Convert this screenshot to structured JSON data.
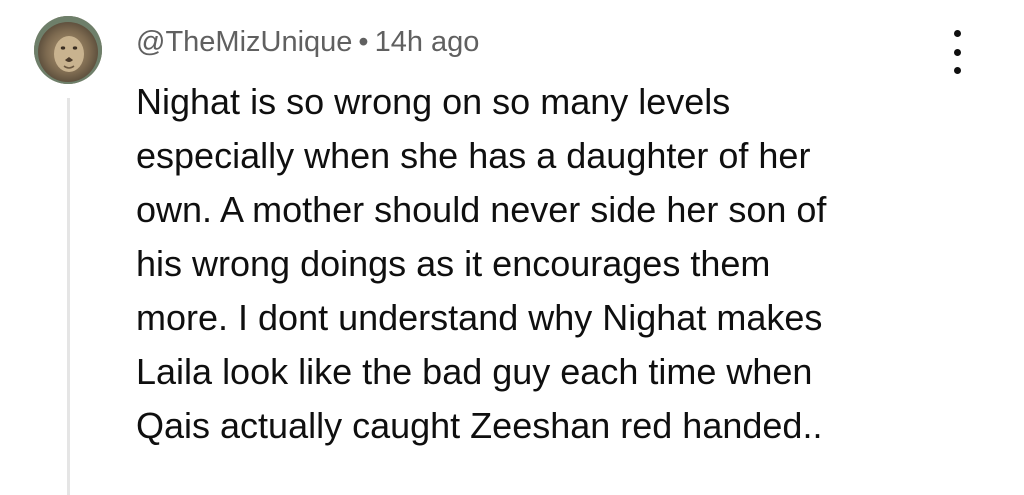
{
  "comment": {
    "avatar_icon": "lion-avatar-icon",
    "author": "@TheMizUnique",
    "separator": "•",
    "time": "14h ago",
    "text_lines": [
      "Nighat is so wrong on so many levels",
      "especially when she has a daughter of her",
      "own. A mother should never side her son of",
      "his wrong doings as it encourages them",
      "more. I dont understand why Nighat makes",
      "Laila look like the bad guy each time when",
      "Qais actually caught Zeeshan red handed.."
    ],
    "more_icon": "more-vertical-icon"
  },
  "colors": {
    "text": "#0f0f0f",
    "meta": "#606060",
    "thread_line": "#e5e5e5"
  }
}
